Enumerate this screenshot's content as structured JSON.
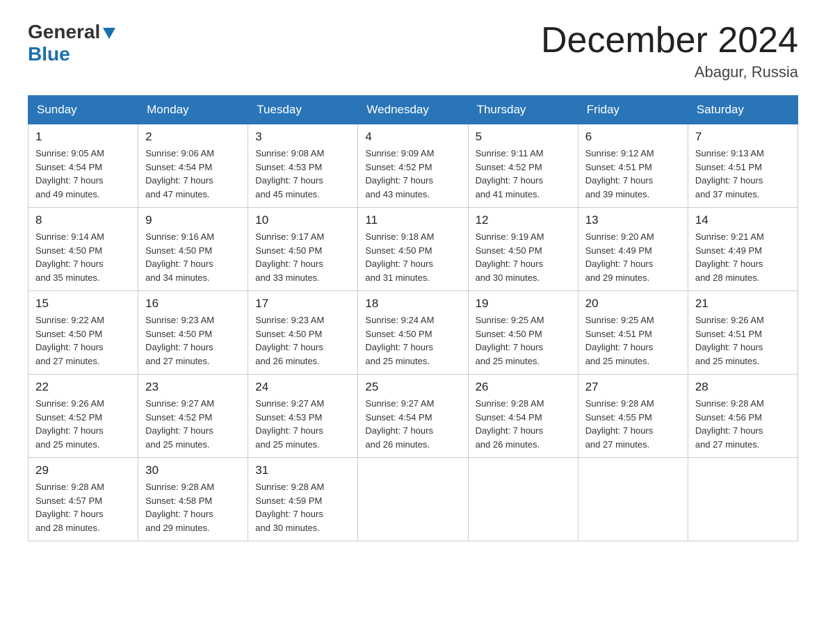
{
  "header": {
    "logo_general": "General",
    "logo_blue": "Blue",
    "month_title": "December 2024",
    "location": "Abagur, Russia"
  },
  "days_of_week": [
    "Sunday",
    "Monday",
    "Tuesday",
    "Wednesday",
    "Thursday",
    "Friday",
    "Saturday"
  ],
  "weeks": [
    [
      {
        "day": "1",
        "sunrise": "9:05 AM",
        "sunset": "4:54 PM",
        "daylight": "7 hours and 49 minutes."
      },
      {
        "day": "2",
        "sunrise": "9:06 AM",
        "sunset": "4:54 PM",
        "daylight": "7 hours and 47 minutes."
      },
      {
        "day": "3",
        "sunrise": "9:08 AM",
        "sunset": "4:53 PM",
        "daylight": "7 hours and 45 minutes."
      },
      {
        "day": "4",
        "sunrise": "9:09 AM",
        "sunset": "4:52 PM",
        "daylight": "7 hours and 43 minutes."
      },
      {
        "day": "5",
        "sunrise": "9:11 AM",
        "sunset": "4:52 PM",
        "daylight": "7 hours and 41 minutes."
      },
      {
        "day": "6",
        "sunrise": "9:12 AM",
        "sunset": "4:51 PM",
        "daylight": "7 hours and 39 minutes."
      },
      {
        "day": "7",
        "sunrise": "9:13 AM",
        "sunset": "4:51 PM",
        "daylight": "7 hours and 37 minutes."
      }
    ],
    [
      {
        "day": "8",
        "sunrise": "9:14 AM",
        "sunset": "4:50 PM",
        "daylight": "7 hours and 35 minutes."
      },
      {
        "day": "9",
        "sunrise": "9:16 AM",
        "sunset": "4:50 PM",
        "daylight": "7 hours and 34 minutes."
      },
      {
        "day": "10",
        "sunrise": "9:17 AM",
        "sunset": "4:50 PM",
        "daylight": "7 hours and 33 minutes."
      },
      {
        "day": "11",
        "sunrise": "9:18 AM",
        "sunset": "4:50 PM",
        "daylight": "7 hours and 31 minutes."
      },
      {
        "day": "12",
        "sunrise": "9:19 AM",
        "sunset": "4:50 PM",
        "daylight": "7 hours and 30 minutes."
      },
      {
        "day": "13",
        "sunrise": "9:20 AM",
        "sunset": "4:49 PM",
        "daylight": "7 hours and 29 minutes."
      },
      {
        "day": "14",
        "sunrise": "9:21 AM",
        "sunset": "4:49 PM",
        "daylight": "7 hours and 28 minutes."
      }
    ],
    [
      {
        "day": "15",
        "sunrise": "9:22 AM",
        "sunset": "4:50 PM",
        "daylight": "7 hours and 27 minutes."
      },
      {
        "day": "16",
        "sunrise": "9:23 AM",
        "sunset": "4:50 PM",
        "daylight": "7 hours and 27 minutes."
      },
      {
        "day": "17",
        "sunrise": "9:23 AM",
        "sunset": "4:50 PM",
        "daylight": "7 hours and 26 minutes."
      },
      {
        "day": "18",
        "sunrise": "9:24 AM",
        "sunset": "4:50 PM",
        "daylight": "7 hours and 25 minutes."
      },
      {
        "day": "19",
        "sunrise": "9:25 AM",
        "sunset": "4:50 PM",
        "daylight": "7 hours and 25 minutes."
      },
      {
        "day": "20",
        "sunrise": "9:25 AM",
        "sunset": "4:51 PM",
        "daylight": "7 hours and 25 minutes."
      },
      {
        "day": "21",
        "sunrise": "9:26 AM",
        "sunset": "4:51 PM",
        "daylight": "7 hours and 25 minutes."
      }
    ],
    [
      {
        "day": "22",
        "sunrise": "9:26 AM",
        "sunset": "4:52 PM",
        "daylight": "7 hours and 25 minutes."
      },
      {
        "day": "23",
        "sunrise": "9:27 AM",
        "sunset": "4:52 PM",
        "daylight": "7 hours and 25 minutes."
      },
      {
        "day": "24",
        "sunrise": "9:27 AM",
        "sunset": "4:53 PM",
        "daylight": "7 hours and 25 minutes."
      },
      {
        "day": "25",
        "sunrise": "9:27 AM",
        "sunset": "4:54 PM",
        "daylight": "7 hours and 26 minutes."
      },
      {
        "day": "26",
        "sunrise": "9:28 AM",
        "sunset": "4:54 PM",
        "daylight": "7 hours and 26 minutes."
      },
      {
        "day": "27",
        "sunrise": "9:28 AM",
        "sunset": "4:55 PM",
        "daylight": "7 hours and 27 minutes."
      },
      {
        "day": "28",
        "sunrise": "9:28 AM",
        "sunset": "4:56 PM",
        "daylight": "7 hours and 27 minutes."
      }
    ],
    [
      {
        "day": "29",
        "sunrise": "9:28 AM",
        "sunset": "4:57 PM",
        "daylight": "7 hours and 28 minutes."
      },
      {
        "day": "30",
        "sunrise": "9:28 AM",
        "sunset": "4:58 PM",
        "daylight": "7 hours and 29 minutes."
      },
      {
        "day": "31",
        "sunrise": "9:28 AM",
        "sunset": "4:59 PM",
        "daylight": "7 hours and 30 minutes."
      },
      null,
      null,
      null,
      null
    ]
  ],
  "labels": {
    "sunrise": "Sunrise:",
    "sunset": "Sunset:",
    "daylight": "Daylight:"
  }
}
